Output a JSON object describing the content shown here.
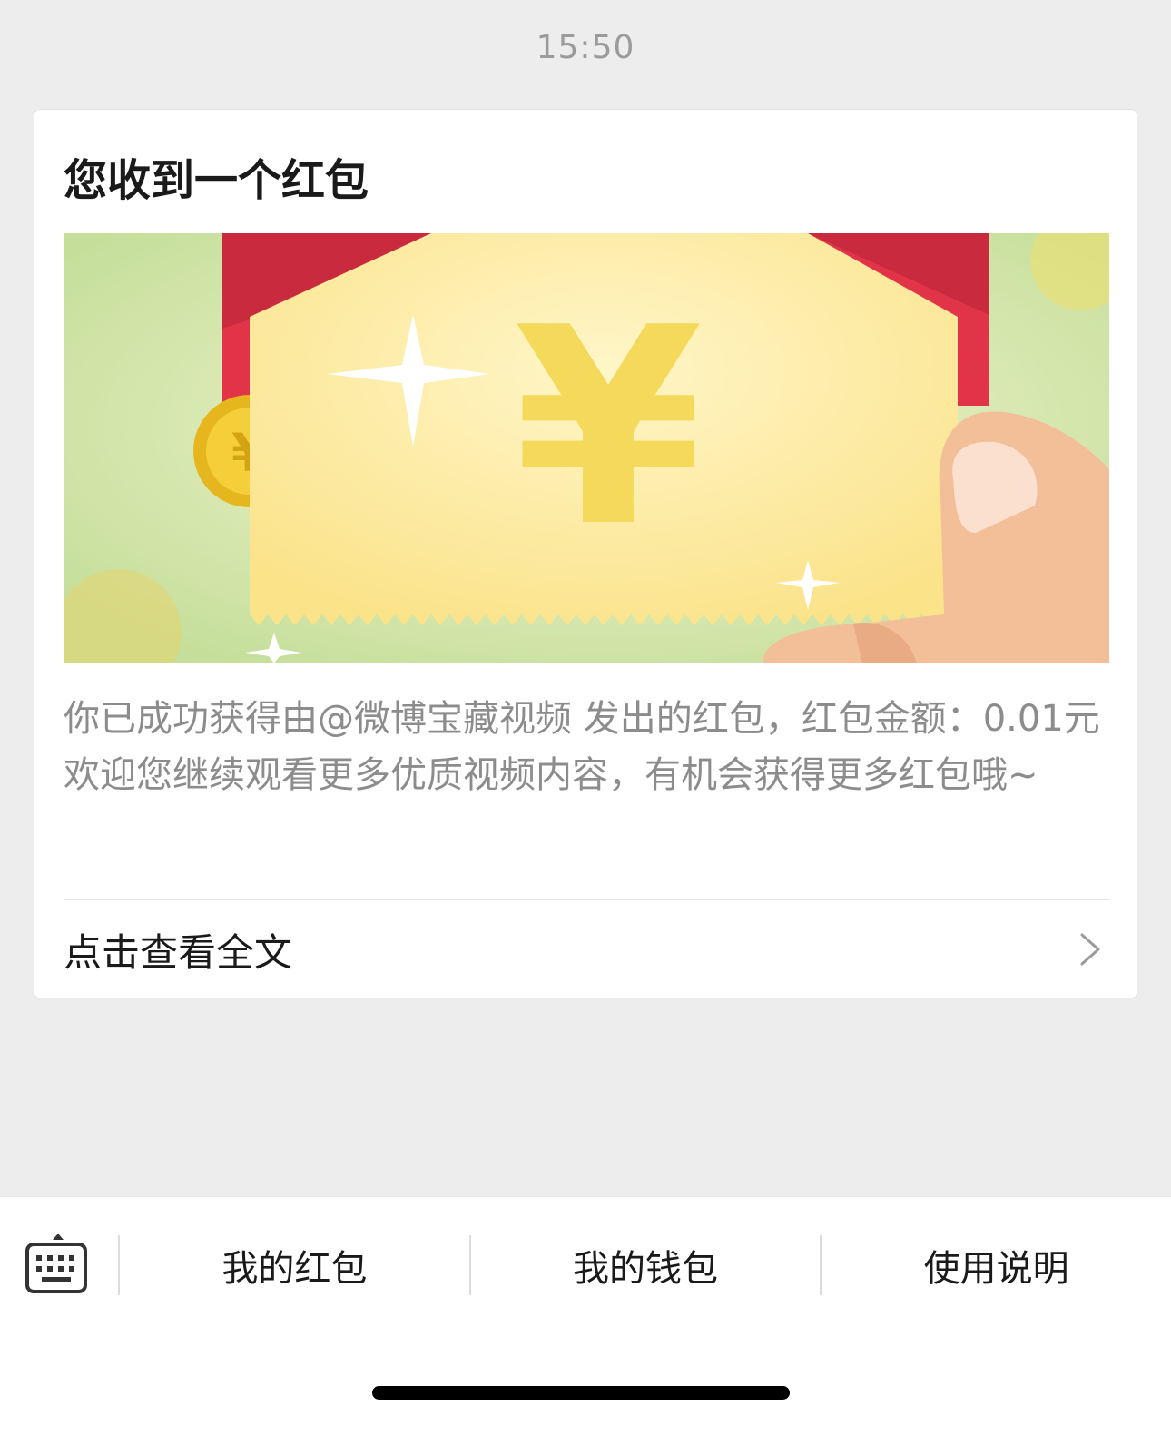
{
  "timestamp": "15:50",
  "card": {
    "title": "您收到一个红包",
    "banner_icon": "red-envelope-yuan-illustration",
    "banner_symbol": "¥",
    "body_text": "你已成功获得由@微博宝藏视频 发出的红包，红包金额：0.01元 欢迎您继续观看更多优质视频内容，有机会获得更多红包哦~",
    "read_more_label": "点击查看全文",
    "read_more_icon": "chevron-right-icon"
  },
  "bottom_bar": {
    "keyboard_icon": "keyboard-icon",
    "menu": [
      {
        "label": "我的红包"
      },
      {
        "label": "我的钱包"
      },
      {
        "label": "使用说明"
      }
    ]
  }
}
